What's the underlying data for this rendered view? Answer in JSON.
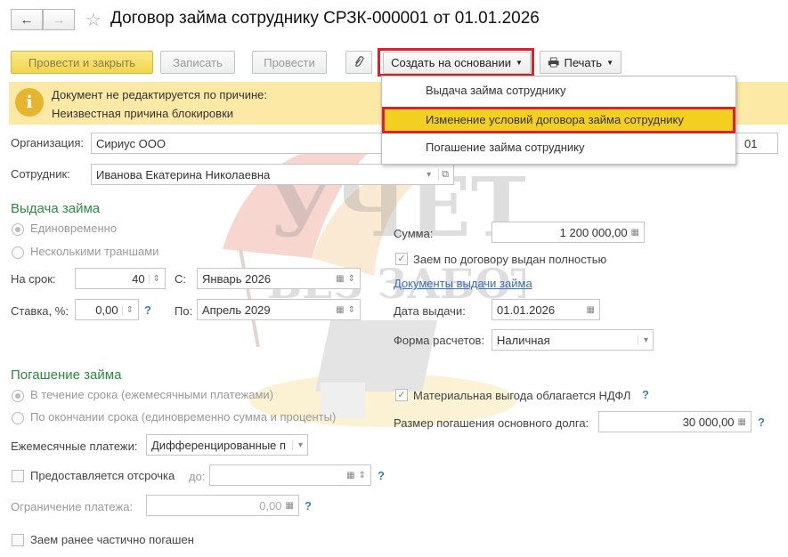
{
  "header": {
    "title": "Договор займа сотруднику СРЗК-000001 от 01.01.2026",
    "back_icon": "←",
    "forward_icon": "→",
    "star_icon": "☆"
  },
  "toolbar": {
    "post_close": "Провести и закрыть",
    "save": "Записать",
    "post": "Провести",
    "create_based": "Создать на основании",
    "print": "Печать"
  },
  "dropdown_menu": {
    "items": [
      "Выдача займа сотруднику",
      "Изменение условий договора займа сотруднику",
      "Погашение займа сотруднику"
    ]
  },
  "banner": {
    "line1": "Документ не редактируется по причине:",
    "line2": "Неизвестная причина блокировки",
    "icon": "i"
  },
  "form": {
    "org_label": "Организация:",
    "org_value": "Сириус ООО",
    "org_right_value": "01",
    "employee_label": "Сотрудник:",
    "employee_value": "Иванова Екатерина Николаевна"
  },
  "issue": {
    "title": "Выдача займа",
    "once": "Единовременно",
    "tranches": "Несколькими траншами",
    "term_label": "На срок:",
    "term_value": "40",
    "from_label": "С:",
    "from_value": "Январь 2026",
    "rate_label": "Ставка, %:",
    "rate_value": "0,00",
    "to_label": "По:",
    "to_value": "Апрель 2029",
    "sum_label": "Сумма:",
    "sum_value": "1 200 000,00",
    "fully_issued": "Заем по договору выдан полностью",
    "docs_link": "Документы выдачи займа",
    "issue_date_label": "Дата выдачи:",
    "issue_date_value": "01.01.2026",
    "payment_form_label": "Форма расчетов:",
    "payment_form_value": "Наличная",
    "help": "?"
  },
  "repay": {
    "title": "Погашение займа",
    "monthly_option": "В течение срока (ежемесячными платежами)",
    "end_option": "По окончании срока (единовременно сумма и проценты)",
    "monthly_label": "Ежемесячные платежи:",
    "monthly_value": "Дифференцированные п",
    "ndfl": "Материальная выгода облагается НДФЛ",
    "repay_amount_label": "Размер погашения основного долга:",
    "repay_amount_value": "30 000,00",
    "deferral": "Предоставляется отсрочка",
    "until_label": "до:",
    "limit_label": "Ограничение платежа:",
    "limit_value": "0,00",
    "partial": "Заем ранее частично погашен",
    "help": "?"
  },
  "watermark": {
    "line1": "УЧЕТ",
    "line2": "БЕЗ ЗАБОТ"
  },
  "colors": {
    "accent_green": "#2a8d3e",
    "primary_button": "#f2d64a",
    "banner": "#fde9a6",
    "highlight": "#f3cf22",
    "red_frame": "#d9232a",
    "link": "#3b6fb6"
  }
}
